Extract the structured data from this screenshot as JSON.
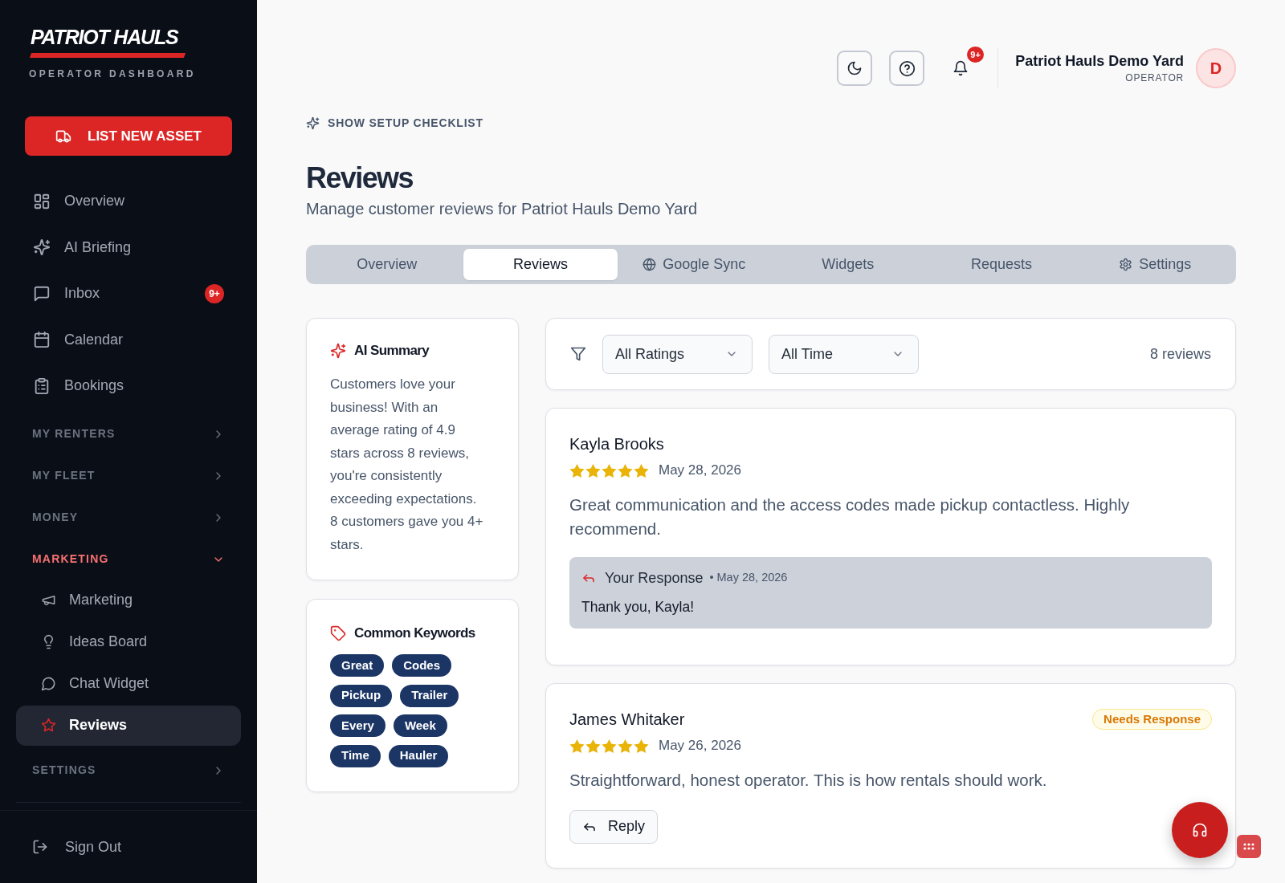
{
  "sidebar": {
    "logo": {
      "title": "PATRIOT HAULS",
      "subtitle": "OPERATOR DASHBOARD"
    },
    "action_button": {
      "label": "LIST NEW ASSET"
    },
    "items": [
      {
        "kind": "link",
        "label": "Overview",
        "selected": false
      },
      {
        "kind": "link",
        "label": "AI Briefing",
        "selected": false
      },
      {
        "kind": "link",
        "label": "Inbox",
        "selected": false,
        "badge": "9+"
      },
      {
        "kind": "link",
        "label": "Calendar",
        "selected": false
      },
      {
        "kind": "link",
        "label": "Bookings",
        "selected": false
      },
      {
        "kind": "section",
        "label": "MY RENTERS",
        "expanded": false
      },
      {
        "kind": "section",
        "label": "MY FLEET",
        "expanded": false
      },
      {
        "kind": "section",
        "label": "MONEY",
        "expanded": false
      },
      {
        "kind": "section",
        "label": "MARKETING",
        "expanded": true,
        "children": [
          {
            "label": "Marketing",
            "selected": false
          },
          {
            "label": "Ideas Board",
            "selected": false
          },
          {
            "label": "Chat Widget",
            "selected": false
          },
          {
            "label": "Reviews",
            "selected": true
          }
        ]
      },
      {
        "kind": "section",
        "label": "SETTINGS",
        "expanded": false
      }
    ],
    "sign_out": {
      "label": "Sign Out"
    }
  },
  "header": {
    "notification_badge": "9+",
    "user": {
      "name": "Patriot Hauls Demo Yard",
      "role": "OPERATOR",
      "initial": "D"
    }
  },
  "setup_link": {
    "label": "SHOW SETUP CHECKLIST"
  },
  "page": {
    "title": "Reviews",
    "subtitle": "Manage customer reviews for Patriot Hauls Demo Yard"
  },
  "tabs": [
    {
      "label": "Overview",
      "selected": false
    },
    {
      "label": "Reviews",
      "selected": true
    },
    {
      "label": "Google Sync",
      "selected": false
    },
    {
      "label": "Widgets",
      "selected": false
    },
    {
      "label": "Requests",
      "selected": false
    },
    {
      "label": "Settings",
      "selected": false
    }
  ],
  "ai_summary": {
    "title": "AI Summary",
    "text": "Customers love your business! With an average rating of 4.9 stars across 8 reviews, you're consistently exceeding expectations. 8 customers gave you 4+ stars."
  },
  "keywords": {
    "title": "Common Keywords",
    "tags": [
      "Great",
      "Codes",
      "Pickup",
      "Trailer",
      "Every",
      "Week",
      "Time",
      "Hauler"
    ]
  },
  "filters": {
    "dropdowns": [
      {
        "value": "All Ratings"
      },
      {
        "value": "All Time"
      }
    ],
    "count": "8 reviews"
  },
  "reviews": [
    {
      "name": "Kayla Brooks",
      "stars": 5,
      "date": "May 28, 2026",
      "text": "Great communication and the access codes made pickup contactless. Highly recommend.",
      "response": {
        "label": "Your Response",
        "date": "• May 28, 2026",
        "text": "Thank you, Kayla!"
      }
    },
    {
      "name": "James Whitaker",
      "stars": 5,
      "date": "May 26, 2026",
      "badge": "Needs Response",
      "text": "Straightforward, honest operator. This is how rentals should work.",
      "reply_button": "Reply"
    }
  ]
}
